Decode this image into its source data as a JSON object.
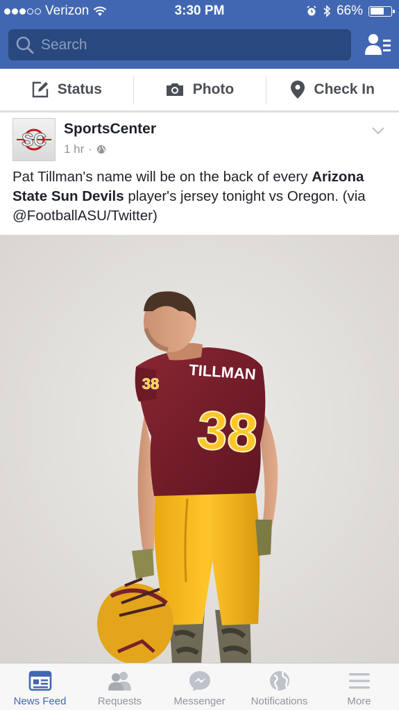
{
  "status_bar": {
    "carrier": "Verizon",
    "time": "3:30 PM",
    "battery_percent": "66%",
    "battery_level": 0.66,
    "signal_bars_filled": 3,
    "signal_bars_total": 5,
    "icons": [
      "wifi-icon",
      "alarm-icon",
      "bluetooth-icon",
      "battery-icon"
    ]
  },
  "header": {
    "search_placeholder": "Search",
    "friends_icon": "friend-requests-icon",
    "color": "#4267b2"
  },
  "composer": {
    "status_label": "Status",
    "photo_label": "Photo",
    "checkin_label": "Check In"
  },
  "post": {
    "page_name": "SportsCenter",
    "avatar_text": "SC",
    "time": "1 hr",
    "separator": "·",
    "privacy_icon": "globe-icon",
    "text_before": "Pat Tillman's name will be on the back of every ",
    "text_bold": "Arizona State Sun Devils",
    "text_after": " player's jersey tonight vs Oregon. (via @FootballASU/Twitter)",
    "photo": {
      "jersey_name": "TILLMAN",
      "jersey_number": "38",
      "sleeve_number": "38"
    }
  },
  "tabs": [
    {
      "label": "News Feed",
      "icon": "news-feed-icon",
      "active": true
    },
    {
      "label": "Requests",
      "icon": "requests-icon",
      "active": false
    },
    {
      "label": "Messenger",
      "icon": "messenger-icon",
      "active": false
    },
    {
      "label": "Notifications",
      "icon": "globe-notifications-icon",
      "active": false
    },
    {
      "label": "More",
      "icon": "menu-icon",
      "active": false
    }
  ],
  "colors": {
    "brand_blue": "#4267b2",
    "search_field": "#29487d",
    "maroon": "#7a1f2b",
    "gold": "#ffc627"
  }
}
